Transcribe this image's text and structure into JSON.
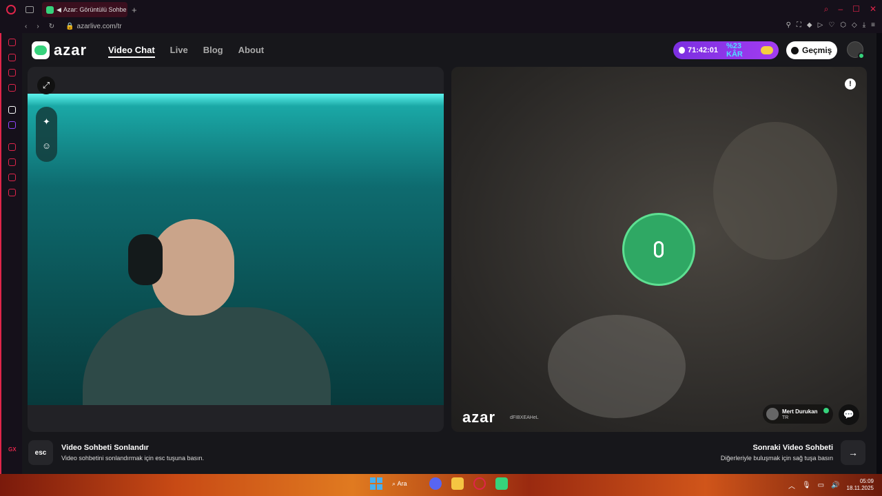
{
  "browser": {
    "tab_title": "Azar: Görüntülü Sohbe",
    "url": "azarlive.com/tr"
  },
  "header": {
    "logo_text": "azar",
    "nav": [
      "Video Chat",
      "Live",
      "Blog",
      "About"
    ],
    "timer": "71:42:01",
    "discount": "%23 KÂR",
    "history_label": "Geçmiş"
  },
  "left_panel": {
    "expand_icon": "expand-icon",
    "tools": [
      "sparkle-icon",
      "smile-icon"
    ]
  },
  "right_panel": {
    "watermark": "azar",
    "watermark_id": "dFIBXEAHeL",
    "peer_name": "Mert Durukan",
    "peer_country": "TR"
  },
  "footer": {
    "esc_key": "esc",
    "end_title": "Video Sohbeti Sonlandır",
    "end_desc": "Video sohbetini sonlandırmak için esc tuşuna basın.",
    "next_title": "Sonraki Video Sohbeti",
    "next_desc": "Diğerleriyle buluşmak için sağ tuşa basın"
  },
  "taskbar": {
    "search_label": "Ara",
    "time": "05:09",
    "date": "18.11.2025"
  },
  "colors": {
    "brand_green": "#36d27c",
    "opera_red": "#e0254a",
    "timer_purple": "#7b2fe0"
  }
}
